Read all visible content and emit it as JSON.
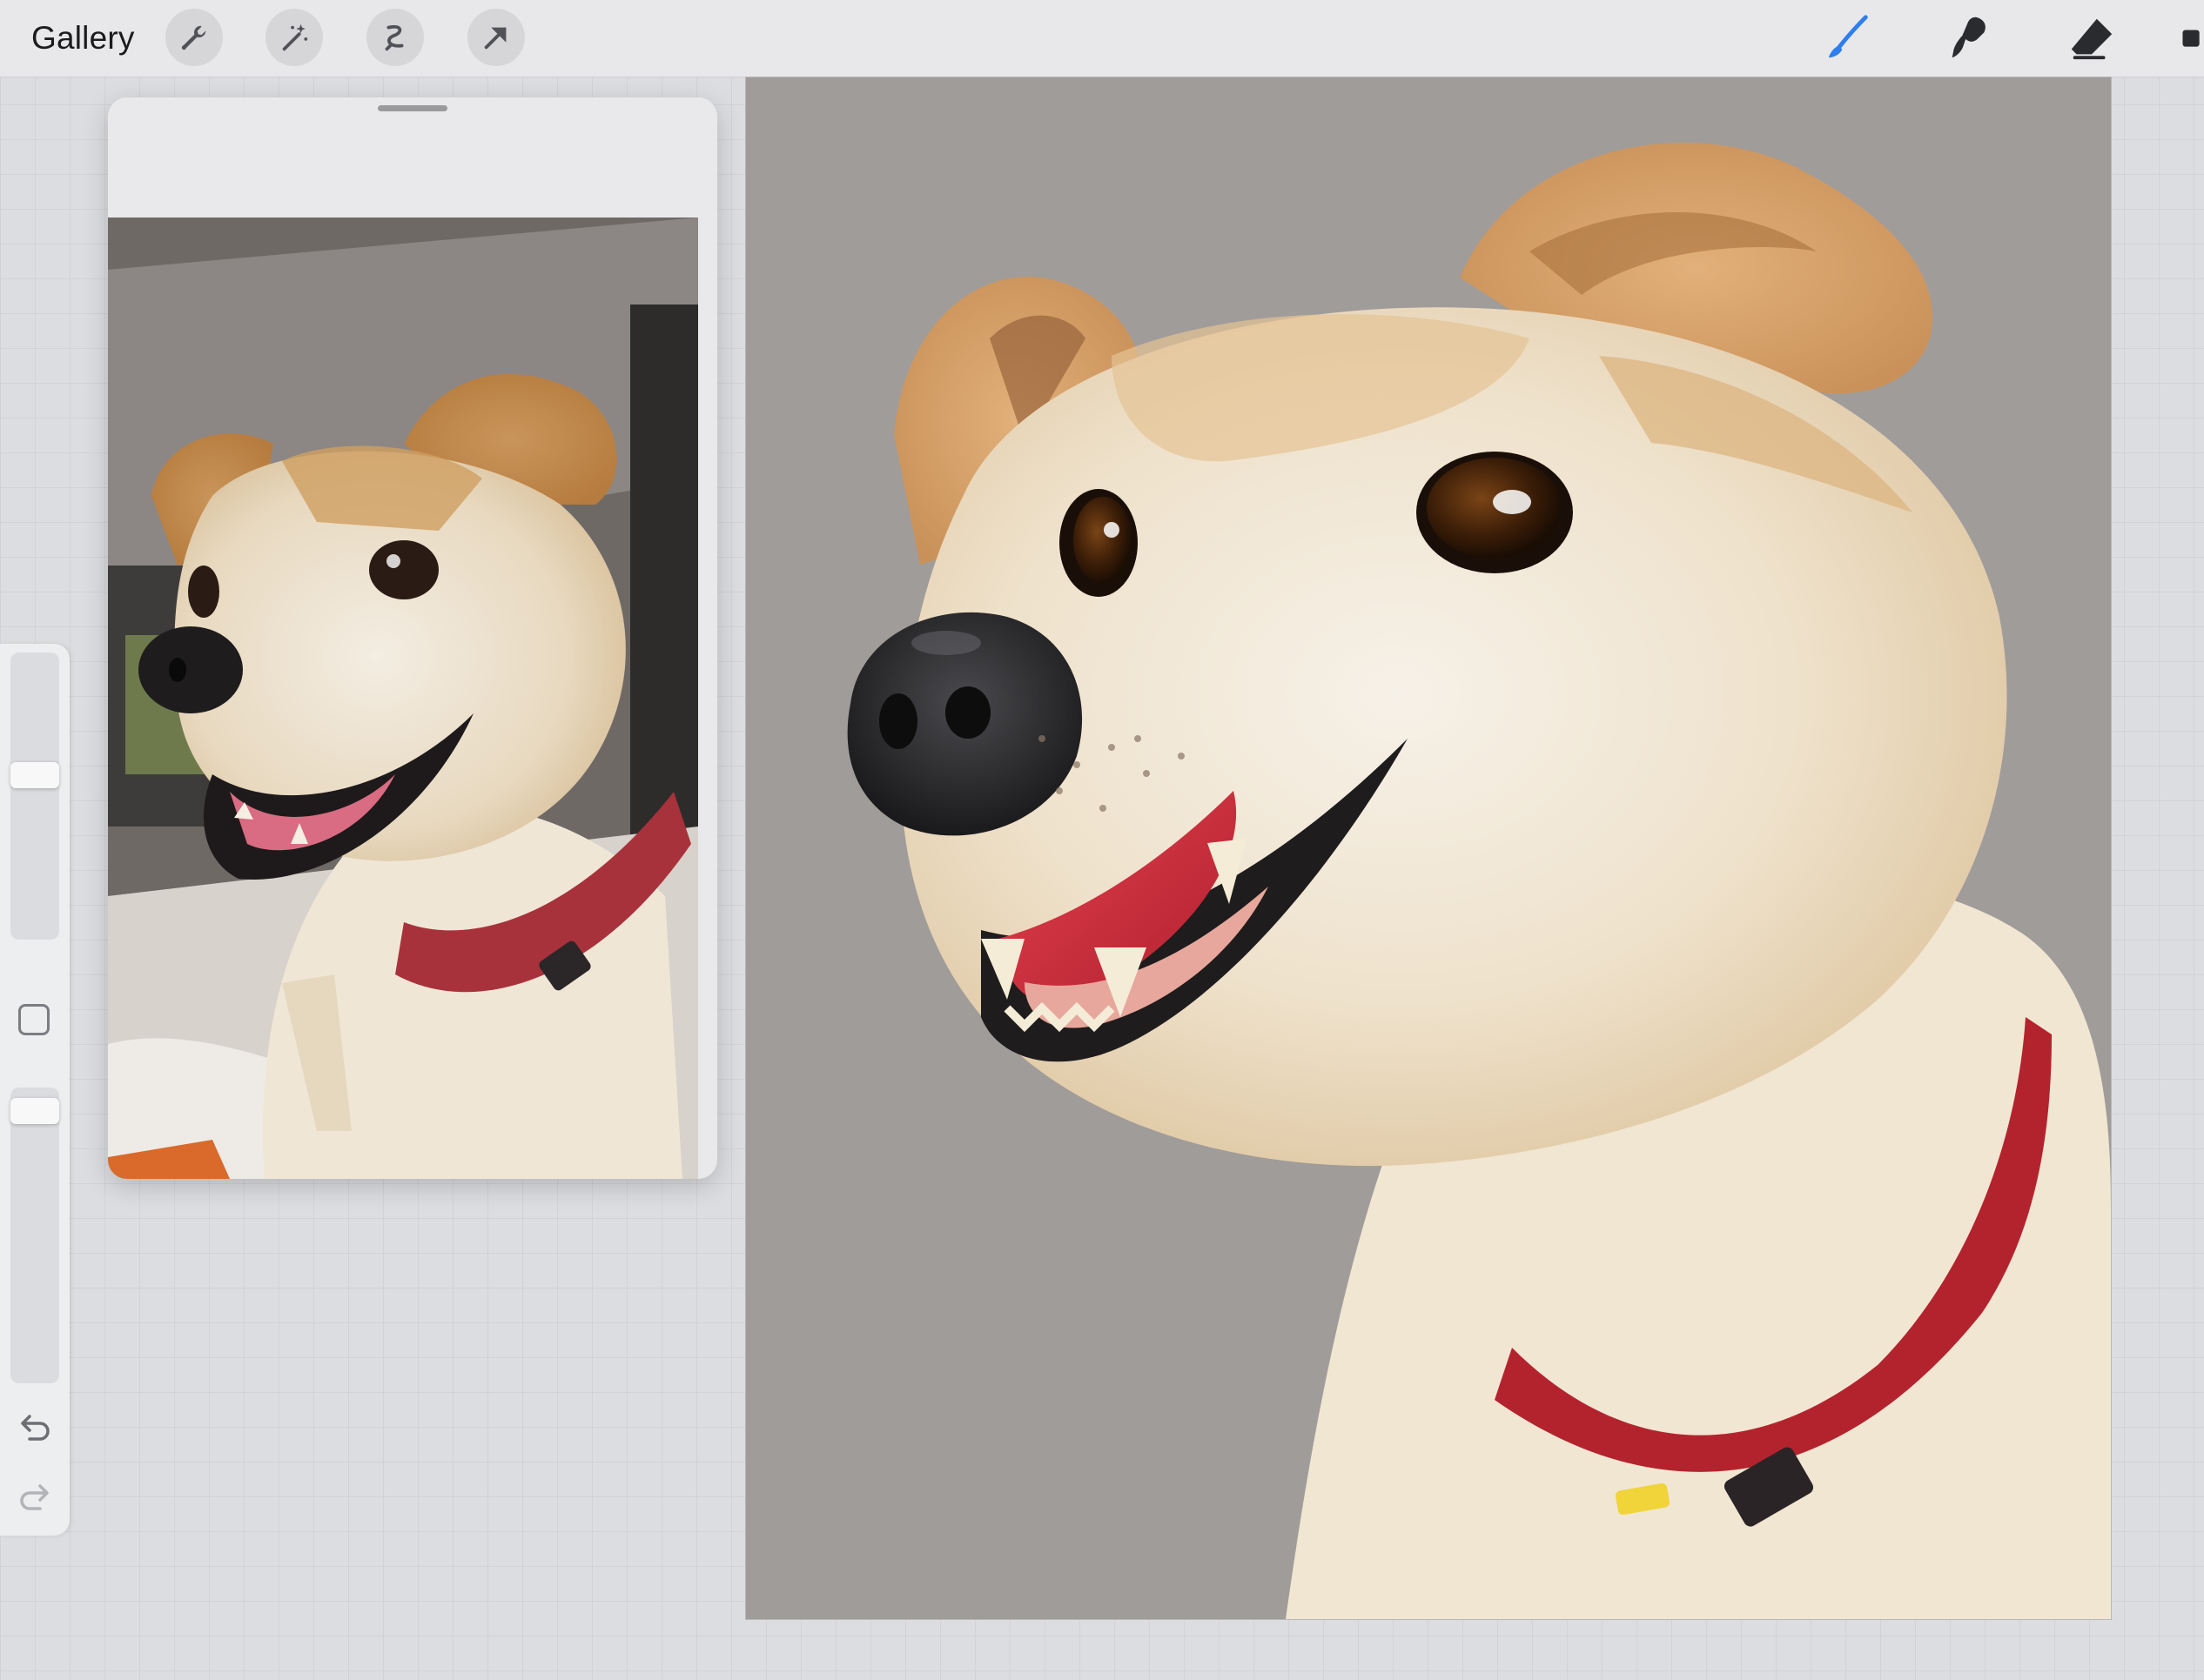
{
  "toolbar": {
    "gallery_label": "Gallery",
    "left_tools": [
      "wrench-icon",
      "magic-wand-icon",
      "selection-icon",
      "transform-arrow-icon"
    ],
    "right_tools": [
      "brush-icon",
      "smudge-icon",
      "eraser-icon",
      "layers-icon"
    ],
    "active_tool": "brush",
    "accent_color": "#2e7ef0"
  },
  "sidebar": {
    "brush_size_level": 0.58,
    "opacity_level": 0.96,
    "icons": [
      "modify-square-icon",
      "undo-icon",
      "redo-icon"
    ]
  },
  "reference": {
    "photo_subject": "dog-photo"
  },
  "canvas": {
    "background_color": "#a09c9a",
    "subject": "dog-painting"
  }
}
